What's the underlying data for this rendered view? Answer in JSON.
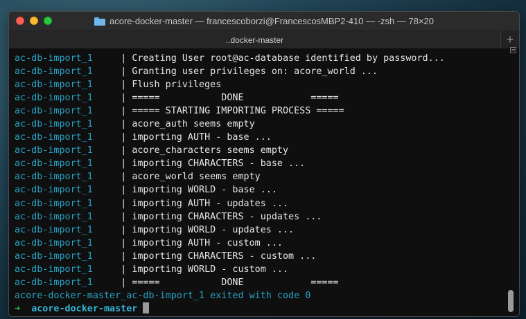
{
  "window": {
    "title": "acore-docker-master — francescoborzi@FrancescosMBP2-410 — -zsh — 78×20",
    "tab_label": "..docker-master",
    "new_tab_symbol": "+"
  },
  "terminal": {
    "service": "ac-db-import_1",
    "separator": "|",
    "lines": [
      "Creating User root@ac-database identified by password...",
      "Granting user privileges on: acore_world ...",
      "Flush privileges",
      "=====           DONE            =====",
      "===== STARTING IMPORTING PROCESS =====",
      "acore_auth seems empty",
      "importing AUTH - base ...",
      "acore_characters seems empty",
      "importing CHARACTERS - base ...",
      "acore_world seems empty",
      "importing WORLD - base ...",
      "importing AUTH - updates ...",
      "importing CHARACTERS - updates ...",
      "importing WORLD - updates ...",
      "importing AUTH - custom ...",
      "importing CHARACTERS - custom ...",
      "importing WORLD - custom ...",
      "=====           DONE            ====="
    ],
    "exit_line": "acore-docker-master_ac-db-import_1 exited with code 0",
    "prompt_arrow": "➜",
    "prompt_dir": "acore-docker-master"
  },
  "colors": {
    "service": "#28a4c6",
    "prompt_arrow": "#2fc45b",
    "prompt_dir": "#34b5d8"
  }
}
